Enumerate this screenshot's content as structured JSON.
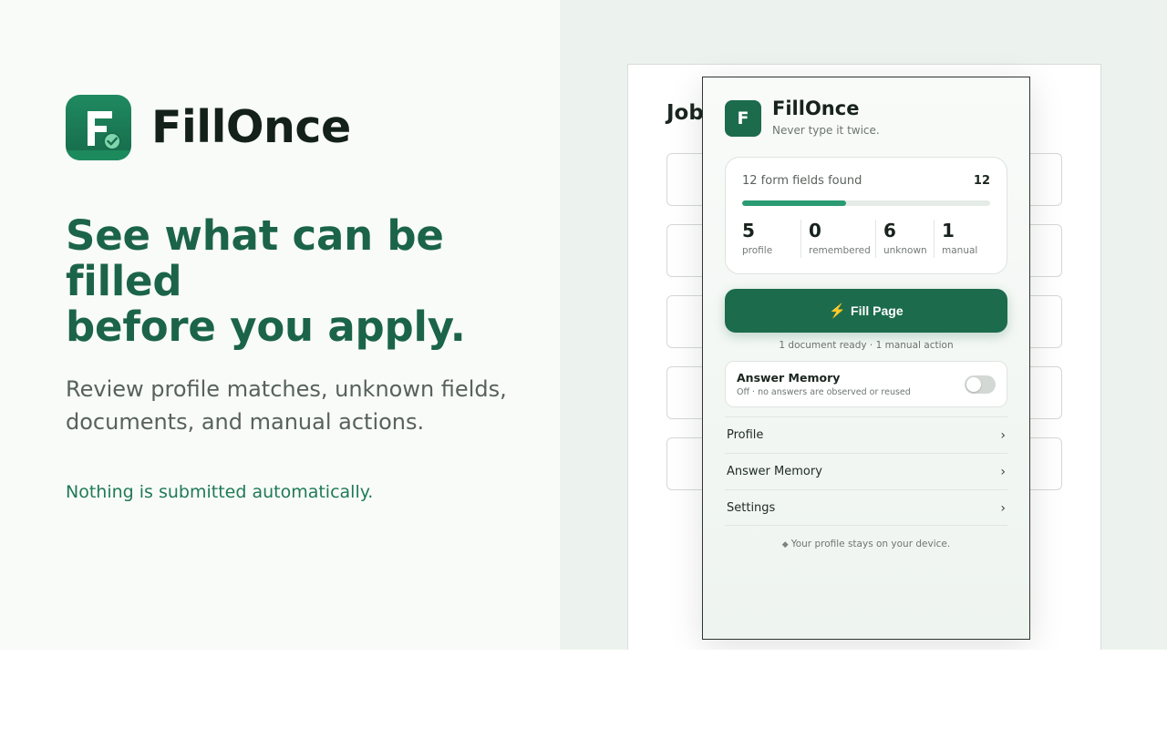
{
  "brand": {
    "name": "FillOnce",
    "logo_letter": "F"
  },
  "hero": {
    "headline_lines": [
      "See what can be",
      "filled",
      "before you apply."
    ],
    "subtext": "Review profile matches, unknown fields, documents, and manual actions.",
    "note": "Nothing is submitted automatically."
  },
  "job_page": {
    "title": "Job"
  },
  "popup": {
    "title": "FillOnce",
    "tagline": "Never type it twice.",
    "logo_letter": "F",
    "summary": {
      "label": "12 form fields found",
      "count": "12",
      "progress": 0.42,
      "stats": [
        {
          "value": "5",
          "label": "profile"
        },
        {
          "value": "0",
          "label": "remembered"
        },
        {
          "value": "6",
          "label": "unknown"
        },
        {
          "value": "1",
          "label": "manual"
        }
      ]
    },
    "fill_button": {
      "icon": "⚡",
      "label": "Fill Page"
    },
    "ready_text": "1 document ready · 1 manual action",
    "answer_memory": {
      "title": "Answer Memory",
      "subtitle": "Off · no answers are observed or reused",
      "enabled": false
    },
    "nav": [
      {
        "label": "Profile",
        "chevron": "›"
      },
      {
        "label": "Answer Memory",
        "chevron": "›"
      },
      {
        "label": "Settings",
        "chevron": "›"
      }
    ],
    "privacy": {
      "icon": "◆",
      "text": "Your profile stays on your device."
    }
  },
  "colors": {
    "brand_green": "#1c6b4d",
    "headline_green": "#1b644a",
    "progress_green": "#2a9b73",
    "bolt_yellow": "#f4c62a"
  }
}
